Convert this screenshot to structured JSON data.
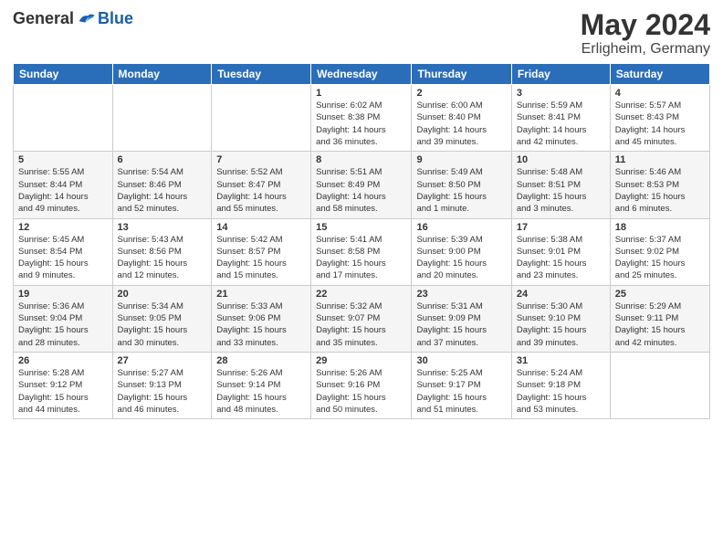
{
  "logo": {
    "general": "General",
    "blue": "Blue"
  },
  "title": "May 2024",
  "subtitle": "Erligheim, Germany",
  "header_days": [
    "Sunday",
    "Monday",
    "Tuesday",
    "Wednesday",
    "Thursday",
    "Friday",
    "Saturday"
  ],
  "weeks": [
    [
      {
        "day": "",
        "info": ""
      },
      {
        "day": "",
        "info": ""
      },
      {
        "day": "",
        "info": ""
      },
      {
        "day": "1",
        "info": "Sunrise: 6:02 AM\nSunset: 8:38 PM\nDaylight: 14 hours\nand 36 minutes."
      },
      {
        "day": "2",
        "info": "Sunrise: 6:00 AM\nSunset: 8:40 PM\nDaylight: 14 hours\nand 39 minutes."
      },
      {
        "day": "3",
        "info": "Sunrise: 5:59 AM\nSunset: 8:41 PM\nDaylight: 14 hours\nand 42 minutes."
      },
      {
        "day": "4",
        "info": "Sunrise: 5:57 AM\nSunset: 8:43 PM\nDaylight: 14 hours\nand 45 minutes."
      }
    ],
    [
      {
        "day": "5",
        "info": "Sunrise: 5:55 AM\nSunset: 8:44 PM\nDaylight: 14 hours\nand 49 minutes."
      },
      {
        "day": "6",
        "info": "Sunrise: 5:54 AM\nSunset: 8:46 PM\nDaylight: 14 hours\nand 52 minutes."
      },
      {
        "day": "7",
        "info": "Sunrise: 5:52 AM\nSunset: 8:47 PM\nDaylight: 14 hours\nand 55 minutes."
      },
      {
        "day": "8",
        "info": "Sunrise: 5:51 AM\nSunset: 8:49 PM\nDaylight: 14 hours\nand 58 minutes."
      },
      {
        "day": "9",
        "info": "Sunrise: 5:49 AM\nSunset: 8:50 PM\nDaylight: 15 hours\nand 1 minute."
      },
      {
        "day": "10",
        "info": "Sunrise: 5:48 AM\nSunset: 8:51 PM\nDaylight: 15 hours\nand 3 minutes."
      },
      {
        "day": "11",
        "info": "Sunrise: 5:46 AM\nSunset: 8:53 PM\nDaylight: 15 hours\nand 6 minutes."
      }
    ],
    [
      {
        "day": "12",
        "info": "Sunrise: 5:45 AM\nSunset: 8:54 PM\nDaylight: 15 hours\nand 9 minutes."
      },
      {
        "day": "13",
        "info": "Sunrise: 5:43 AM\nSunset: 8:56 PM\nDaylight: 15 hours\nand 12 minutes."
      },
      {
        "day": "14",
        "info": "Sunrise: 5:42 AM\nSunset: 8:57 PM\nDaylight: 15 hours\nand 15 minutes."
      },
      {
        "day": "15",
        "info": "Sunrise: 5:41 AM\nSunset: 8:58 PM\nDaylight: 15 hours\nand 17 minutes."
      },
      {
        "day": "16",
        "info": "Sunrise: 5:39 AM\nSunset: 9:00 PM\nDaylight: 15 hours\nand 20 minutes."
      },
      {
        "day": "17",
        "info": "Sunrise: 5:38 AM\nSunset: 9:01 PM\nDaylight: 15 hours\nand 23 minutes."
      },
      {
        "day": "18",
        "info": "Sunrise: 5:37 AM\nSunset: 9:02 PM\nDaylight: 15 hours\nand 25 minutes."
      }
    ],
    [
      {
        "day": "19",
        "info": "Sunrise: 5:36 AM\nSunset: 9:04 PM\nDaylight: 15 hours\nand 28 minutes."
      },
      {
        "day": "20",
        "info": "Sunrise: 5:34 AM\nSunset: 9:05 PM\nDaylight: 15 hours\nand 30 minutes."
      },
      {
        "day": "21",
        "info": "Sunrise: 5:33 AM\nSunset: 9:06 PM\nDaylight: 15 hours\nand 33 minutes."
      },
      {
        "day": "22",
        "info": "Sunrise: 5:32 AM\nSunset: 9:07 PM\nDaylight: 15 hours\nand 35 minutes."
      },
      {
        "day": "23",
        "info": "Sunrise: 5:31 AM\nSunset: 9:09 PM\nDaylight: 15 hours\nand 37 minutes."
      },
      {
        "day": "24",
        "info": "Sunrise: 5:30 AM\nSunset: 9:10 PM\nDaylight: 15 hours\nand 39 minutes."
      },
      {
        "day": "25",
        "info": "Sunrise: 5:29 AM\nSunset: 9:11 PM\nDaylight: 15 hours\nand 42 minutes."
      }
    ],
    [
      {
        "day": "26",
        "info": "Sunrise: 5:28 AM\nSunset: 9:12 PM\nDaylight: 15 hours\nand 44 minutes."
      },
      {
        "day": "27",
        "info": "Sunrise: 5:27 AM\nSunset: 9:13 PM\nDaylight: 15 hours\nand 46 minutes."
      },
      {
        "day": "28",
        "info": "Sunrise: 5:26 AM\nSunset: 9:14 PM\nDaylight: 15 hours\nand 48 minutes."
      },
      {
        "day": "29",
        "info": "Sunrise: 5:26 AM\nSunset: 9:16 PM\nDaylight: 15 hours\nand 50 minutes."
      },
      {
        "day": "30",
        "info": "Sunrise: 5:25 AM\nSunset: 9:17 PM\nDaylight: 15 hours\nand 51 minutes."
      },
      {
        "day": "31",
        "info": "Sunrise: 5:24 AM\nSunset: 9:18 PM\nDaylight: 15 hours\nand 53 minutes."
      },
      {
        "day": "",
        "info": ""
      }
    ]
  ]
}
